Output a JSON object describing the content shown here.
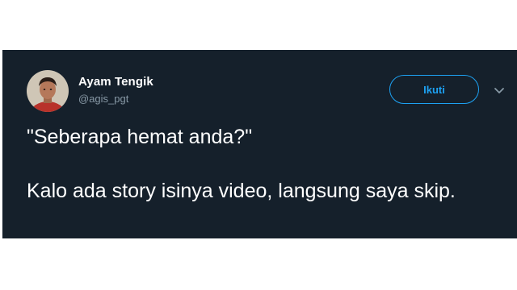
{
  "tweet": {
    "author": {
      "name": "Ayam Tengik",
      "handle": "@agis_pgt",
      "avatar_icon": "user-avatar-photo"
    },
    "follow_button": {
      "label": "Ikuti"
    },
    "menu_icon": "chevron-down-icon",
    "paragraphs": [
      "\"Seberapa hemat anda?\"",
      "Kalo ada story isinya video, langsung saya skip."
    ]
  },
  "colors": {
    "background": "#15202b",
    "accent": "#1da1f2",
    "secondary_text": "#8899a6"
  }
}
